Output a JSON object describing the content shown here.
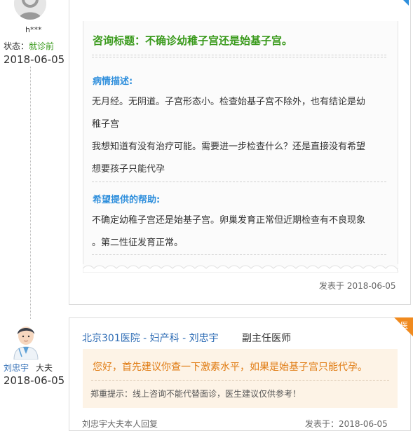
{
  "patient": {
    "username": "h***",
    "status_label": "状态：",
    "status_value": "就诊前",
    "date": "2018-06-05"
  },
  "question": {
    "title": "咨询标题：不确诊幼稚子宫还是始基子宫。",
    "desc_label": "病情描述:",
    "desc_line1": "无月经。无阴道。子宫形态小。检查始基子宫不除外，也有结论是幼",
    "desc_line2": "稚子宫",
    "desc_line3": "我想知道有没有治疗可能。需要进一步检查什么？还是直接没有希望",
    "desc_line4": "想要孩子只能代孕",
    "help_label": "希望提供的帮助:",
    "help_line1": "不确定幼稚子宫还是始基子宫。卵巢发育正常但近期检查有不良现象",
    "help_line2": "。第二性征发育正常。",
    "posted": "发表于 2018-06-05"
  },
  "doctor": {
    "name": "刘忠宇",
    "role": "大夫",
    "date": "2018-06-05",
    "header": "北京301医院 - 妇产科 - 刘忠宇",
    "title": "副主任医师",
    "badge": "医",
    "answer": "您好，首先建议你查一下激素水平，如果是始基子宫只能代孕。",
    "note": "郑重提示：线上咨询不能代替面诊，医生建议仅供参考！",
    "footer_left": "刘忠宇大夫本人回复",
    "footer_right": "发表于：2018-06-05"
  },
  "colors": {
    "accent_blue": "#2f8fdc",
    "accent_green": "#3a9a1c",
    "accent_orange": "#f08a1e"
  }
}
